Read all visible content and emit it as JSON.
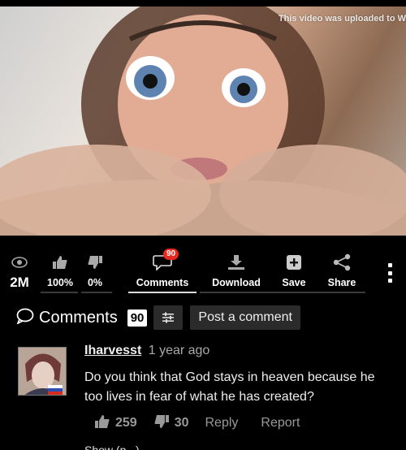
{
  "video": {
    "watermark": "This video was uploaded to W"
  },
  "actions": {
    "views": {
      "value": "2M",
      "icon": "eye-icon"
    },
    "likes": {
      "value": "100%",
      "icon": "thumbs-up-icon"
    },
    "dislikes": {
      "value": "0%",
      "icon": "thumbs-down-icon"
    },
    "comments": {
      "label": "Comments",
      "badge": "90",
      "icon": "speech-bubble-icon"
    },
    "download": {
      "label": "Download",
      "icon": "download-icon"
    },
    "save": {
      "label": "Save",
      "icon": "plus-square-icon"
    },
    "share": {
      "label": "Share",
      "icon": "share-icon"
    },
    "more": {
      "icon": "kebab-menu-icon"
    }
  },
  "comments_section": {
    "title": "Comments",
    "count": "90",
    "filter_icon": "sliders-icon",
    "post_button": "Post a comment"
  },
  "comments": [
    {
      "username": "Iharvesst",
      "time": "1 year ago",
      "text": "Do you think that God stays in heaven because he too lives in fear of what he has created?",
      "upvotes": "259",
      "downvotes": "30",
      "reply_label": "Reply",
      "report_label": "Report",
      "flag": "ru-flag-icon"
    }
  ],
  "next_comment_fragment": "Show (p...)",
  "colors": {
    "background": "#000000",
    "badge": "#e8271e",
    "muted": "#999999"
  }
}
